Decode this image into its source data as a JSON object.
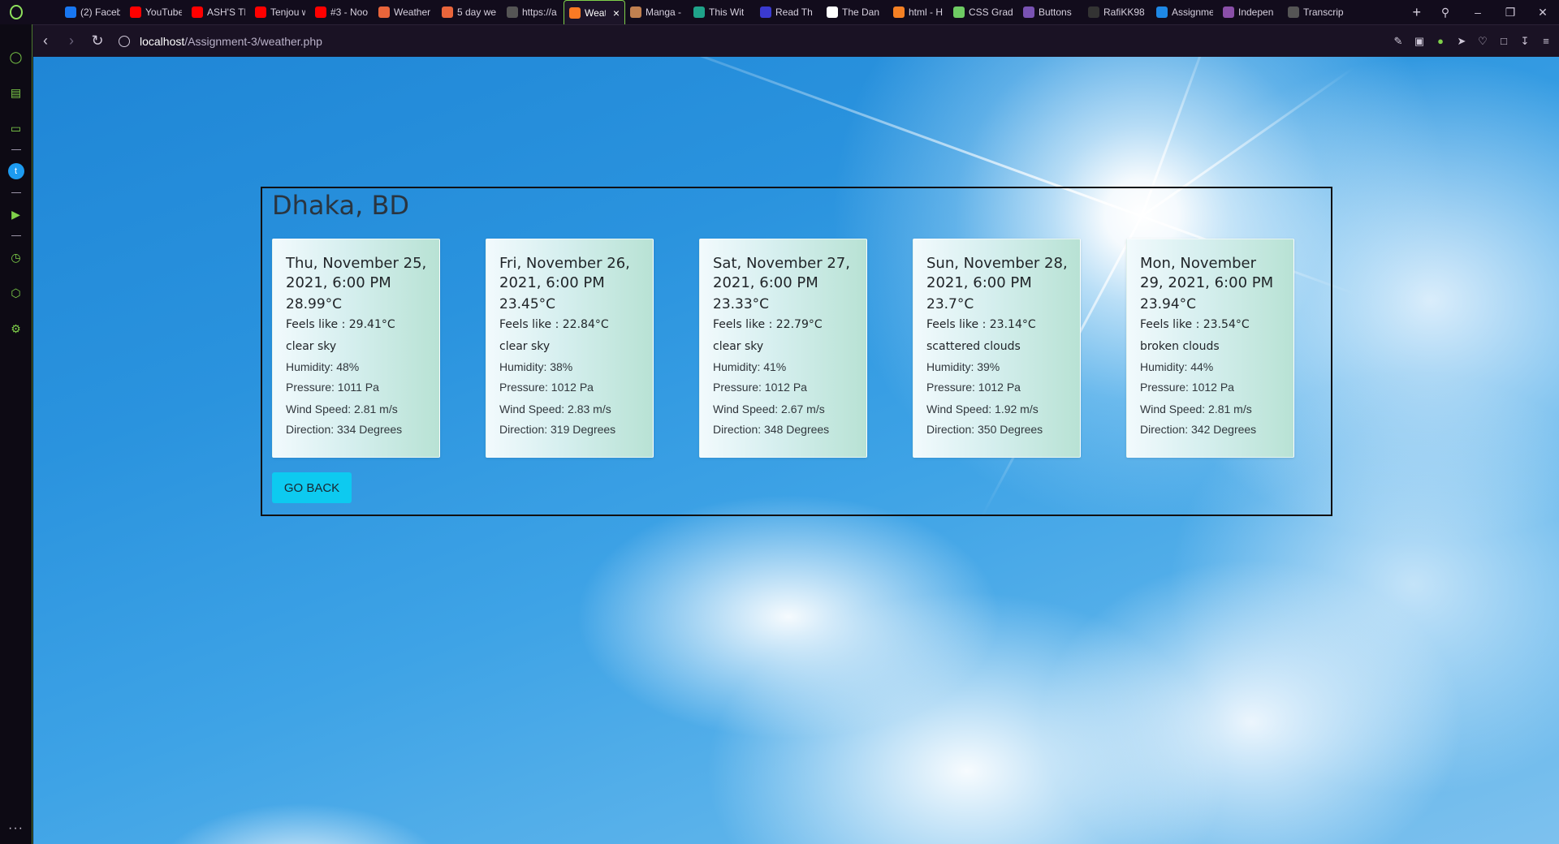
{
  "browser": {
    "tabs": [
      {
        "label": "",
        "favicon": "gamepad-icon",
        "color": "#120c1c"
      },
      {
        "label": "(2) Faceb",
        "favicon": "facebook-icon",
        "color": "#1877f2"
      },
      {
        "label": "YouTube",
        "favicon": "youtube-icon",
        "color": "#ff0000"
      },
      {
        "label": "ASH'S TR",
        "favicon": "youtube-icon",
        "color": "#ff0000"
      },
      {
        "label": "Tenjou w",
        "favicon": "youtube-icon",
        "color": "#ff0000"
      },
      {
        "label": "#3 - Noo",
        "favicon": "youtube-icon",
        "color": "#ff0000"
      },
      {
        "label": "Weather",
        "favicon": "weather-icon",
        "color": "#e9653b"
      },
      {
        "label": "5 day we",
        "favicon": "weather-icon",
        "color": "#e9653b"
      },
      {
        "label": "https://a",
        "favicon": "globe-icon",
        "color": "#555555"
      },
      {
        "label": "Weat",
        "favicon": "xampp-icon",
        "color": "#fb7a24",
        "active": true
      },
      {
        "label": "Manga -",
        "favicon": "manga-icon",
        "color": "#c08050"
      },
      {
        "label": "This Wit",
        "favicon": "book-icon",
        "color": "#1fa38a"
      },
      {
        "label": "Read Th",
        "favicon": "book-icon",
        "color": "#3a3ad0"
      },
      {
        "label": "The Dan",
        "favicon": "google-icon",
        "color": "#ffffff"
      },
      {
        "label": "html - H",
        "favicon": "stackoverflow-icon",
        "color": "#f48024"
      },
      {
        "label": "CSS Grad",
        "favicon": "css-icon",
        "color": "#6ecb63"
      },
      {
        "label": "Buttons",
        "favicon": "bootstrap-icon",
        "color": "#7952b3"
      },
      {
        "label": "RafiKK98",
        "favicon": "github-icon",
        "color": "#333333"
      },
      {
        "label": "Assignme",
        "favicon": "classroom-icon",
        "color": "#1e88e5"
      },
      {
        "label": "Indepen",
        "favicon": "leaf-icon",
        "color": "#8a4fa8"
      },
      {
        "label": "Transcrip",
        "favicon": "globe-icon",
        "color": "#555555"
      }
    ],
    "url_host": "localhost",
    "url_path": "/Assignment-3/weather.php"
  },
  "page": {
    "city": "Dhaka, BD",
    "forecast": [
      {
        "date": "Thu, November 25, 2021, 6:00 PM",
        "temp": "28.99°C",
        "feels": "Feels like : 29.41°C",
        "desc": "clear sky",
        "humidity": "Humidity: 48%",
        "pressure": "Pressure: 1011 Pa",
        "wind": "Wind Speed: 2.81 m/s",
        "direction": "Direction: 334 Degrees"
      },
      {
        "date": "Fri, November 26, 2021, 6:00 PM",
        "temp": "23.45°C",
        "feels": "Feels like : 22.84°C",
        "desc": "clear sky",
        "humidity": "Humidity: 38%",
        "pressure": "Pressure: 1012 Pa",
        "wind": "Wind Speed: 2.83 m/s",
        "direction": "Direction: 319 Degrees"
      },
      {
        "date": "Sat, November 27, 2021, 6:00 PM",
        "temp": "23.33°C",
        "feels": "Feels like : 22.79°C",
        "desc": "clear sky",
        "humidity": "Humidity: 41%",
        "pressure": "Pressure: 1012 Pa",
        "wind": "Wind Speed: 2.67 m/s",
        "direction": "Direction: 348 Degrees"
      },
      {
        "date": "Sun, November 28, 2021, 6:00 PM",
        "temp": "23.7°C",
        "feels": "Feels like : 23.14°C",
        "desc": "scattered clouds",
        "humidity": "Humidity: 39%",
        "pressure": "Pressure: 1012 Pa",
        "wind": "Wind Speed: 1.92 m/s",
        "direction": "Direction: 350 Degrees"
      },
      {
        "date": "Mon, November 29, 2021, 6:00 PM",
        "temp": "23.94°C",
        "feels": "Feels like : 23.54°C",
        "desc": "broken clouds",
        "humidity": "Humidity: 44%",
        "pressure": "Pressure: 1012 Pa",
        "wind": "Wind Speed: 2.81 m/s",
        "direction": "Direction: 342 Degrees"
      }
    ],
    "go_back_label": "GO BACK"
  }
}
